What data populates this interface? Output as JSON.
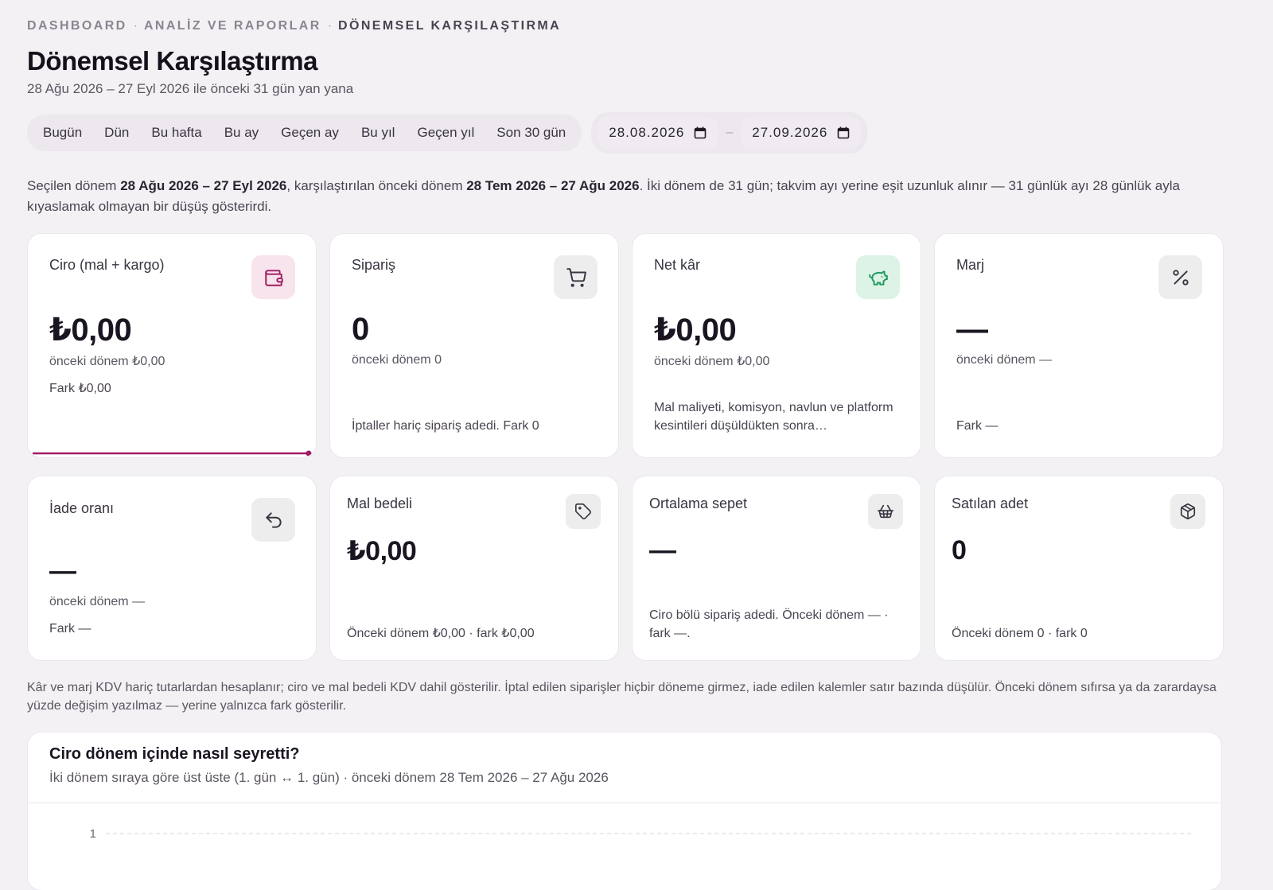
{
  "breadcrumb": {
    "items": [
      "DASHBOARD",
      "ANALİZ VE RAPORLAR"
    ],
    "current": "DÖNEMSEL KARŞILAŞTIRMA",
    "separator": "·"
  },
  "page": {
    "title": "Dönemsel Karşılaştırma",
    "subtitle": "28 Ağu 2026 – 27 Eyl 2026 ile önceki 31 gün yan yana"
  },
  "presets": [
    "Bugün",
    "Dün",
    "Bu hafta",
    "Bu ay",
    "Geçen ay",
    "Bu yıl",
    "Geçen yıl",
    "Son 30 gün"
  ],
  "date_range": {
    "start": "28.08.2026",
    "end": "27.09.2026",
    "separator": "–"
  },
  "info": {
    "p1": "Seçilen dönem ",
    "b1": "28 Ağu 2026 – 27 Eyl 2026",
    "p2": ", karşılaştırılan önceki dönem ",
    "b2": "28 Tem 2026 – 27 Ağu 2026",
    "p3": ". İki dönem de 31 gün; takvim ayı yerine eşit uzunluk alınır — 31 günlük ayı 28 günlük ayla kıyaslamak olmayan bir düşüş gösterirdi."
  },
  "cards": {
    "ciro": {
      "label": "Ciro (mal + kargo)",
      "value": "₺0,00",
      "prev": "önceki dönem ₺0,00",
      "diff": "Fark ₺0,00",
      "icon": "wallet-icon"
    },
    "siparis": {
      "label": "Sipariş",
      "value": "0",
      "prev": "önceki dönem 0",
      "note": "İptaller hariç sipariş adedi. Fark 0",
      "icon": "cart-icon"
    },
    "netkar": {
      "label": "Net kâr",
      "value": "₺0,00",
      "prev": "önceki dönem ₺0,00",
      "note": "Mal maliyeti, komisyon, navlun ve platform kesintileri düşüldükten sonra…",
      "icon": "piggy-bank-icon"
    },
    "marj": {
      "label": "Marj",
      "value": "—",
      "prev": "önceki dönem —",
      "note": "Fark —",
      "icon": "percent-icon"
    },
    "iade": {
      "label": "İade oranı",
      "value": "—",
      "prev": "önceki dönem —",
      "diff": "Fark —",
      "icon": "undo-icon"
    },
    "malbedeli": {
      "label": "Mal bedeli",
      "value": "₺0,00",
      "note": "Önceki dönem ₺0,00 · fark ₺0,00",
      "icon": "tag-icon"
    },
    "sepet": {
      "label": "Ortalama sepet",
      "value": "—",
      "note": "Ciro bölü sipariş adedi. Önceki dönem — · fark —.",
      "icon": "basket-icon"
    },
    "adet": {
      "label": "Satılan adet",
      "value": "0",
      "note": "Önceki dönem 0 · fark 0",
      "icon": "box-icon"
    }
  },
  "colors": {
    "accent": "#a01a62",
    "pink_tint": "#f7e4ed",
    "green": "#1f9a5c",
    "green_tint": "#dcf3e6"
  },
  "footnote": "Kâr ve marj KDV hariç tutarlardan hesaplanır; ciro ve mal bedeli KDV dahil gösterilir. İptal edilen siparişler hiçbir döneme girmez, iade edilen kalemler satır bazında düşülür. Önceki dönem sıfırsa ya da zarardaysa yüzde değişim yazılmaz — yerine yalnızca fark gösterilir.",
  "chart": {
    "title": "Ciro dönem içinde nasıl seyretti?",
    "subtitle": "İki dönem sıraya göre üst üste (1. gün ↔ 1. gün) · önceki dönem 28 Tem 2026 – 27 Ağu 2026"
  },
  "chart_data": {
    "type": "line",
    "title": "Ciro dönem içinde nasıl seyretti?",
    "y_ticks": [
      "1"
    ],
    "grid": true,
    "series": []
  }
}
